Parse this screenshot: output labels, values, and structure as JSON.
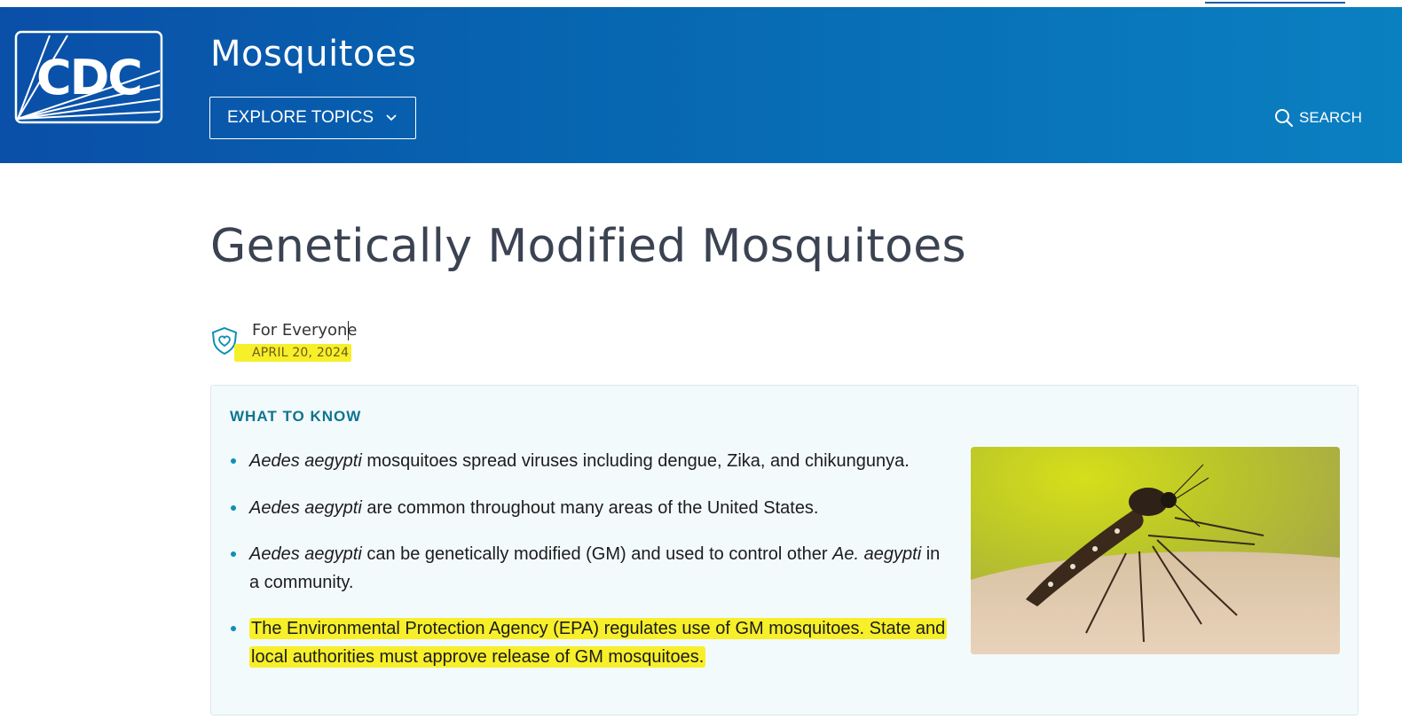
{
  "header": {
    "logo_text": "CDC",
    "site_title": "Mosquitoes",
    "explore_label": "EXPLORE TOPICS",
    "search_label": "SEARCH"
  },
  "page": {
    "title": "Genetically Modified Mosquitoes",
    "audience": "For Everyone",
    "date": "APRIL 20, 2024"
  },
  "what_to_know": {
    "heading": "WHAT TO KNOW",
    "items": [
      {
        "em": "Aedes aegypti",
        "text": " mosquitoes spread viruses including dengue, Zika, and chikungunya."
      },
      {
        "em": "Aedes aegypti",
        "text": " are common throughout many areas of the United States."
      },
      {
        "em": "Aedes aegypti",
        "text": " can be genetically modified (GM) and used to control other ",
        "em2": "Ae. aegypti",
        "text2": " in a community."
      },
      {
        "text": "The Environmental Protection Agency (EPA) regulates use of GM mosquitoes. State and local authorities must approve release of GM mosquitoes."
      }
    ]
  },
  "colors": {
    "header_start": "#0a4fa8",
    "header_end": "#0a80c1",
    "accent_teal": "#0e7490",
    "highlight": "#f7ef2a"
  },
  "icons": [
    "cdc-logo",
    "chevron-down-icon",
    "search-icon",
    "shield-heart-icon",
    "mosquito-photo"
  ]
}
